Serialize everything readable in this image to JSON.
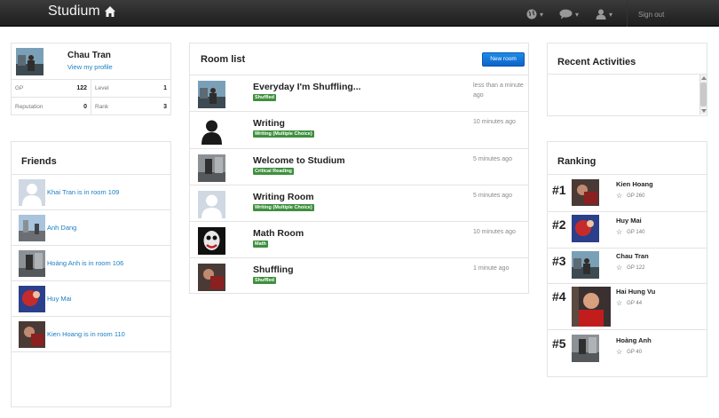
{
  "navbar": {
    "brand": "Studium",
    "icons": [
      "globe-icon",
      "chat-icon",
      "user-icon"
    ],
    "sign_out": "Sign out"
  },
  "profile": {
    "name": "Chau Tran",
    "view_link": "View my profile",
    "stats": [
      {
        "label": "GP",
        "value": "122"
      },
      {
        "label": "Level",
        "value": "1"
      },
      {
        "label": "Reputation",
        "value": "0"
      },
      {
        "label": "Rank",
        "value": "3"
      }
    ]
  },
  "friends": {
    "title": "Friends",
    "items": [
      {
        "text": "Khai Tran is in room 109"
      },
      {
        "text": "Anh Dang"
      },
      {
        "text": "Hoàng Anh is in room 106"
      },
      {
        "text": "Huy Mai"
      },
      {
        "text": "Kien Hoang is in room 110"
      }
    ]
  },
  "rooms": {
    "title": "Room list",
    "new_room": "New room",
    "items": [
      {
        "title": "Everyday I'm Shuffling...",
        "tag": "Shuffled",
        "time": "less than a minute ago"
      },
      {
        "title": "Writing",
        "tag": "Writing (Multiple Choice)",
        "time": "10 minutes ago"
      },
      {
        "title": "Welcome to Studium",
        "tag": "Critical Reading",
        "time": "5 minutes ago"
      },
      {
        "title": "Writing Room",
        "tag": "Writing (Multiple Choice)",
        "time": "5 minutes ago"
      },
      {
        "title": "Math Room",
        "tag": "Math",
        "time": "10 minutes ago"
      },
      {
        "title": "Shuffling",
        "tag": "Shuffled",
        "time": "1 minute ago"
      }
    ]
  },
  "recent": {
    "title": "Recent Activities"
  },
  "ranking": {
    "title": "Ranking",
    "items": [
      {
        "rank": "#1",
        "name": "Kien Hoang",
        "gp": "GP 260"
      },
      {
        "rank": "#2",
        "name": "Huy Mai",
        "gp": "GP 140"
      },
      {
        "rank": "#3",
        "name": "Chau Tran",
        "gp": "GP 122"
      },
      {
        "rank": "#4",
        "name": "Hai Hung Vu",
        "gp": "GP 44"
      },
      {
        "rank": "#5",
        "name": "Hoàng Anh",
        "gp": "GP 40"
      }
    ]
  },
  "colors": {
    "accent": "#1a7ec4",
    "tag_green": "#3e8f3e",
    "button_blue": "#0d63c9"
  }
}
